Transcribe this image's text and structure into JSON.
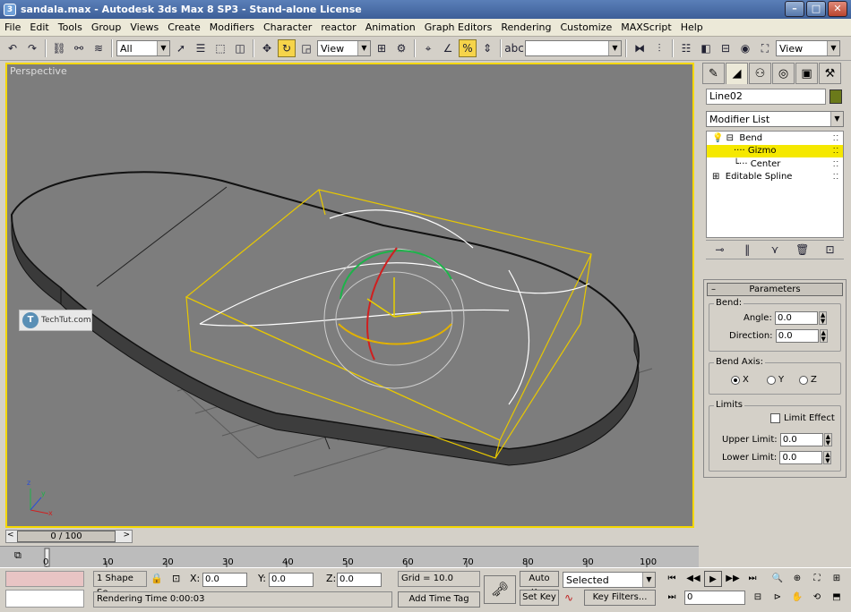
{
  "window": {
    "title": "sandala.max - Autodesk 3ds Max 8 SP3  - Stand-alone License"
  },
  "menu": [
    "File",
    "Edit",
    "Tools",
    "Group",
    "Views",
    "Create",
    "Modifiers",
    "Character",
    "reactor",
    "Animation",
    "Graph Editors",
    "Rendering",
    "Customize",
    "MAXScript",
    "Help"
  ],
  "toolbar": {
    "selection_filter": "All",
    "ref_coord": "View",
    "named_selection": "",
    "render_view": "View"
  },
  "viewport": {
    "label": "Perspective",
    "watermark": "TechTut.com"
  },
  "command_panel": {
    "object_name": "Line02",
    "object_color": "#6b7a1a",
    "modifier_list": "Modifier List",
    "stack": [
      {
        "label": "Bend",
        "level": 0,
        "selected": false
      },
      {
        "label": "Gizmo",
        "level": 1,
        "selected": true
      },
      {
        "label": "Center",
        "level": 1,
        "selected": false
      },
      {
        "label": "Editable Spline",
        "level": 0,
        "selected": false
      }
    ],
    "rollout_title": "Parameters",
    "bend_group": "Bend:",
    "angle_label": "Angle:",
    "angle_value": "0.0",
    "direction_label": "Direction:",
    "direction_value": "0.0",
    "axis_group": "Bend Axis:",
    "axis_x": "X",
    "axis_y": "Y",
    "axis_z": "Z",
    "selected_axis": "X",
    "limits_group": "Limits",
    "limit_effect": "Limit Effect",
    "upper_label": "Upper Limit:",
    "upper_value": "0.0",
    "lower_label": "Lower Limit:",
    "lower_value": "0.0"
  },
  "timeline": {
    "frame_display": "0 / 100",
    "ticks": [
      "0",
      "10",
      "20",
      "30",
      "40",
      "50",
      "60",
      "70",
      "80",
      "90",
      "100"
    ]
  },
  "status": {
    "selection": "1 Shape Se",
    "x_label": "X:",
    "x_value": "0.0",
    "y_label": "Y:",
    "y_value": "0.0",
    "z_label": "Z:",
    "z_value": "0.0",
    "grid": "Grid = 10.0",
    "prompt": "Rendering Time  0:00:03",
    "add_time_tag": "Add Time Tag",
    "auto_key": "Auto Key",
    "set_key": "Set Key",
    "key_mode": "Selected",
    "key_filters": "Key Filters...",
    "current_frame": "0"
  }
}
